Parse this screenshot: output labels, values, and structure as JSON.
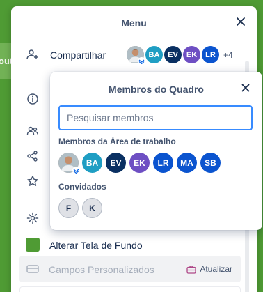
{
  "background": {
    "board_text": "out",
    "color": "#4f9b34"
  },
  "menu": {
    "title": "Menu",
    "share": {
      "label": "Compartilhar",
      "avatars": [
        {
          "initials": "",
          "kind": "photo",
          "color": "#8d6e63"
        },
        {
          "initials": "BA",
          "kind": "initials",
          "color": "#1f9ec3"
        },
        {
          "initials": "EV",
          "kind": "initials",
          "color": "#0a3062"
        },
        {
          "initials": "EK",
          "kind": "initials",
          "color": "#6e4fc3"
        },
        {
          "initials": "LR",
          "kind": "initials",
          "color": "#0b54cf"
        }
      ],
      "more": "+4"
    },
    "background_item": {
      "label": "Alterar Tela de Fundo",
      "swatch_color": "#4f9b34"
    },
    "custom_fields": {
      "label": "Campos Personalizados",
      "upgrade_label": "Atualizar"
    }
  },
  "popover": {
    "title": "Membros do Quadro",
    "search_placeholder": "Pesquisar membros",
    "workspace_section": "Membros da Área de trabalho",
    "workspace_members": [
      {
        "initials": "",
        "kind": "photo",
        "color": "#8d6e63"
      },
      {
        "initials": "BA",
        "kind": "initials",
        "color": "#1f9ec3"
      },
      {
        "initials": "EV",
        "kind": "initials",
        "color": "#0a3062"
      },
      {
        "initials": "EK",
        "kind": "initials",
        "color": "#6e4fc3"
      },
      {
        "initials": "LR",
        "kind": "initials",
        "color": "#0b54cf"
      },
      {
        "initials": "MA",
        "kind": "initials",
        "color": "#0b54cf"
      },
      {
        "initials": "SB",
        "kind": "initials",
        "color": "#0b54cf"
      }
    ],
    "guests_section": "Convidados",
    "guests": [
      {
        "initials": "F",
        "kind": "guest"
      },
      {
        "initials": "K",
        "kind": "guest"
      }
    ]
  }
}
